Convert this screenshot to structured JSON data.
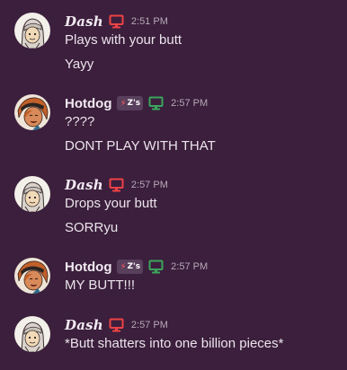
{
  "messages": [
    {
      "author": "Dash",
      "author_style": "dash",
      "device_icon": "monitor-icon",
      "device_color": "#ed4245",
      "timestamp": "2:51 PM",
      "lines": [
        "Plays with your butt",
        "Yayy"
      ]
    },
    {
      "author": "Hotdog",
      "author_style": "hotdog",
      "tag": "Z's",
      "tag_icon": "lightning-bolt-icon",
      "device_icon": "monitor-icon",
      "device_color": "#3ba55c",
      "timestamp": "2:57 PM",
      "lines": [
        "????",
        "DONT PLAY WITH THAT"
      ]
    },
    {
      "author": "Dash",
      "author_style": "dash",
      "device_icon": "monitor-icon",
      "device_color": "#ed4245",
      "timestamp": "2:57 PM",
      "lines": [
        "Drops your butt",
        "SORRyu"
      ]
    },
    {
      "author": "Hotdog",
      "author_style": "hotdog",
      "tag": "Z's",
      "tag_icon": "lightning-bolt-icon",
      "device_icon": "monitor-icon",
      "device_color": "#3ba55c",
      "timestamp": "2:57 PM",
      "lines": [
        "MY BUTT!!!"
      ]
    },
    {
      "author": "Dash",
      "author_style": "dash",
      "device_icon": "monitor-icon",
      "device_color": "#ed4245",
      "timestamp": "2:57 PM",
      "lines": [
        "*Butt shatters into one billion pieces*"
      ]
    }
  ],
  "colors": {
    "background": "#3b1f3c",
    "text": "#ece4ec",
    "timestamp": "#b7a9b8"
  }
}
